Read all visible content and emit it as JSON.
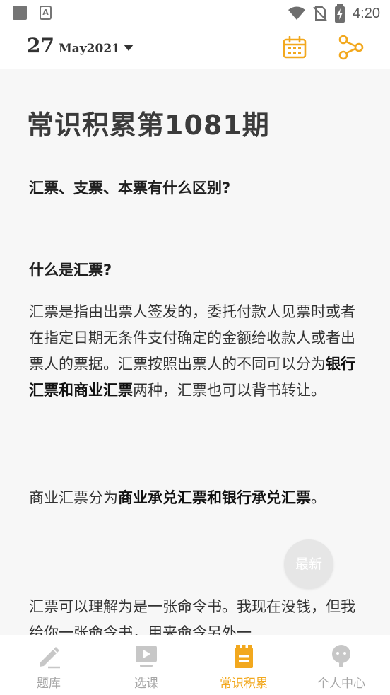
{
  "status_bar": {
    "app_icon_letter": "A",
    "time": "4:20"
  },
  "header": {
    "day": "27",
    "month_year": "May2021"
  },
  "article": {
    "title": "常识积累第1081期",
    "question": "汇票、支票、本票有什么区别?",
    "subheading": "什么是汇票?",
    "para1_part1": "汇票是指由出票人签发的，委托付款人见票时或者在指定日期无条件支付确定的金额给收款人或者出票人的票据。汇票按照出票人的不同可以分为",
    "para1_bold": "银行汇票和商业汇票",
    "para1_part2": "两种，汇票也可以背书转让。",
    "para2_part1": "商业汇票分为",
    "para2_bold": "商业承兑汇票和银行承兑汇票",
    "para2_part2": "。",
    "para3": "汇票可以理解为是一张命令书。我现在没钱，但我给你一张命令书，用来命令另外一"
  },
  "float_button": {
    "label": "最新"
  },
  "bottom_nav": {
    "items": [
      {
        "label": "题库",
        "icon": "pencil-icon"
      },
      {
        "label": "选课",
        "icon": "play-icon"
      },
      {
        "label": "常识积累",
        "icon": "notepad-icon"
      },
      {
        "label": "个人中心",
        "icon": "user-icon"
      }
    ],
    "active_index": 2
  },
  "colors": {
    "accent": "#f2a81e",
    "inactive": "#a6a6a6",
    "content_bg": "#f7f7f7"
  }
}
